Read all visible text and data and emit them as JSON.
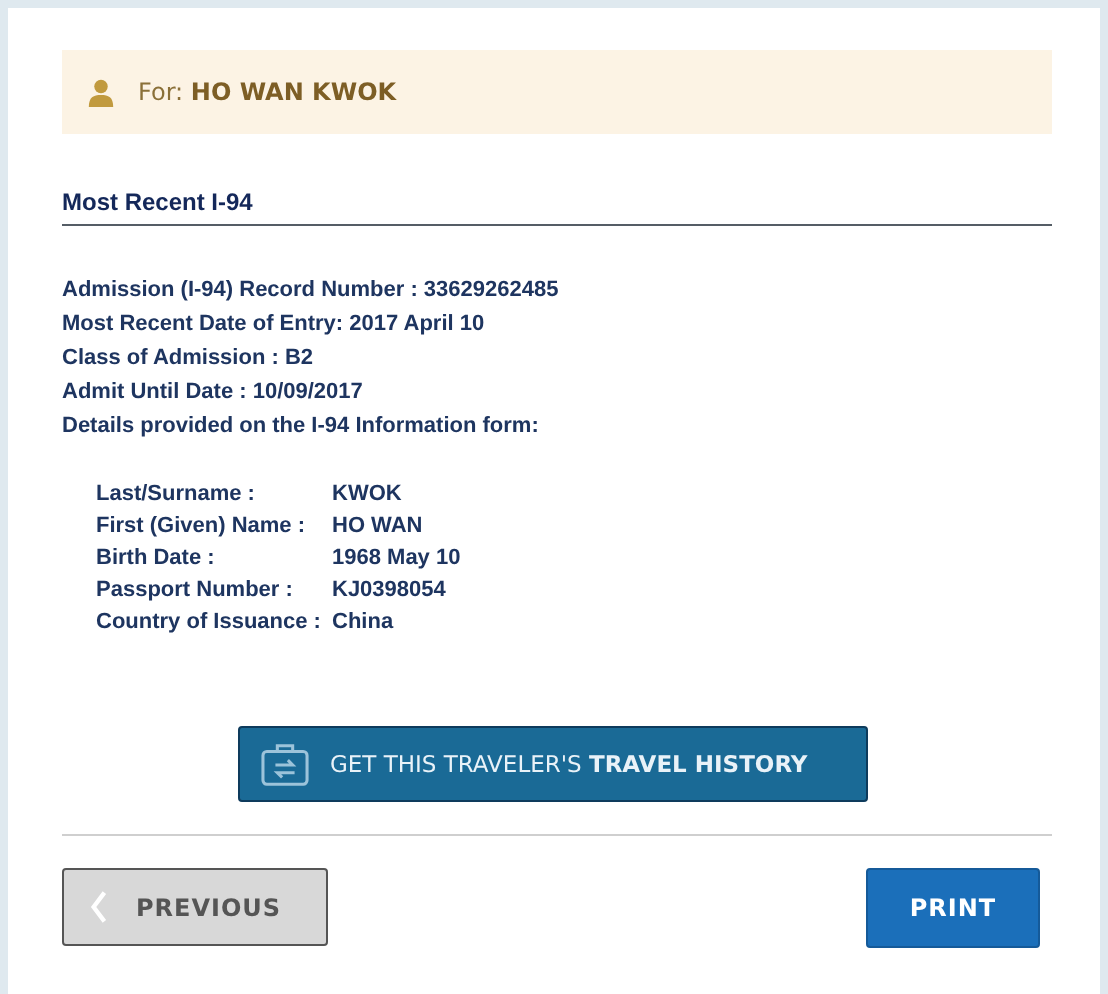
{
  "traveler_banner": {
    "text": "For: **HO WAN KWOK**"
  },
  "section": {
    "title": "Most Recent I-94"
  },
  "summary_lines": [
    "Admission (I-94) Record Number : 33629262485",
    "Most Recent Date of Entry: 2017 April 10",
    "Class of Admission : B2",
    "Admit Until Date : 10/09/2017",
    "Details provided on the I-94 Information form:"
  ],
  "details": [
    {
      "label": "Last/Surname :",
      "value": "KWOK"
    },
    {
      "label": "First (Given) Name :",
      "value": "HO WAN"
    },
    {
      "label": "Birth Date :",
      "value": "1968 May 10"
    },
    {
      "label": "Passport Number :",
      "value": "KJ0398054"
    },
    {
      "label": "Country of Issuance :",
      "value": "China"
    }
  ],
  "travel_history_button": {
    "label": "GET THIS TRAVELER'S **TRAVEL HISTORY**"
  },
  "buttons": [
    {
      "label": "PREVIOUS",
      "kind": "back"
    },
    {
      "label": "PRINT",
      "kind": "primary"
    }
  ]
}
